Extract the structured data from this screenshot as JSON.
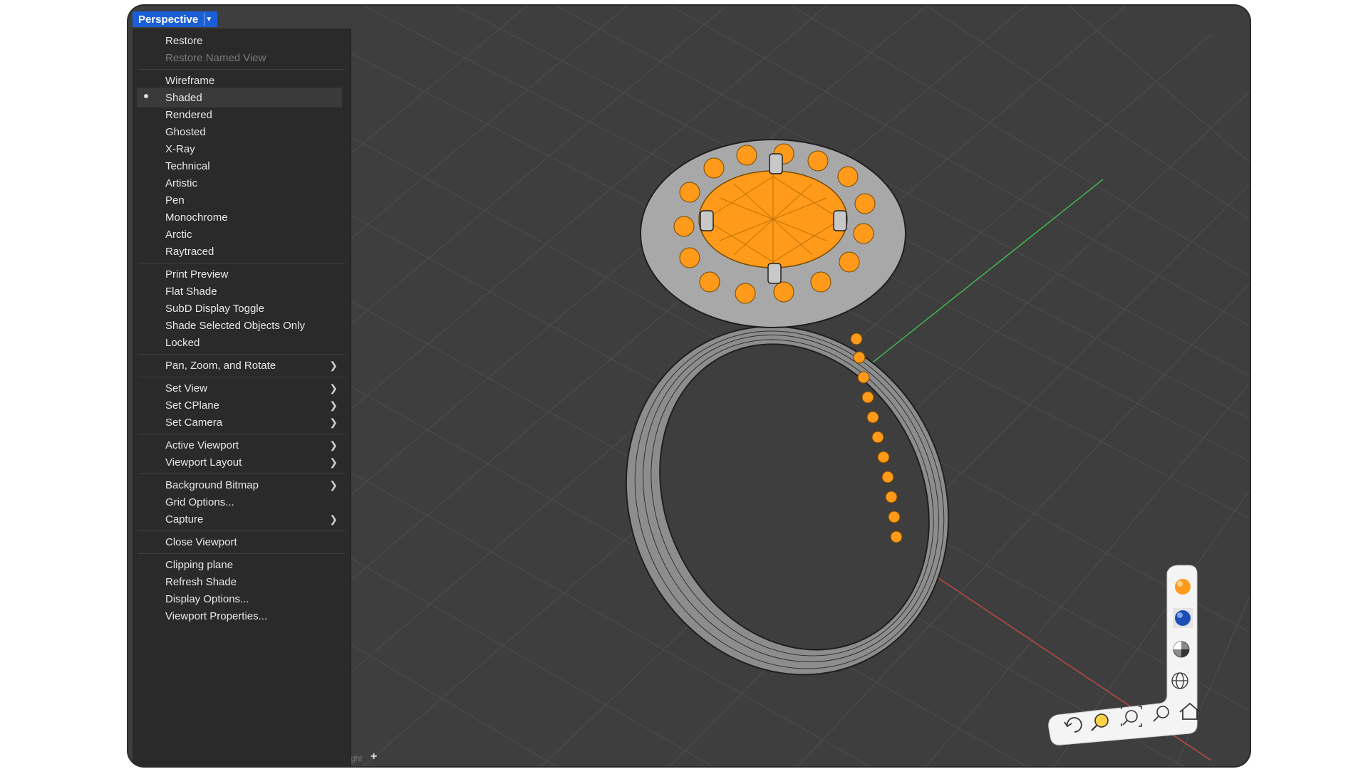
{
  "viewport": {
    "title": "Perspective",
    "dropdown_icon": "chevron-down-icon",
    "bottom_tab_fragment": "ght",
    "add_tab_icon": "plus-icon"
  },
  "menu": {
    "items": [
      {
        "label": "Restore"
      },
      {
        "label": "Restore Named View",
        "disabled": true
      },
      {
        "label": "Wireframe"
      },
      {
        "label": "Shaded",
        "checked": true
      },
      {
        "label": "Rendered"
      },
      {
        "label": "Ghosted"
      },
      {
        "label": "X-Ray"
      },
      {
        "label": "Technical"
      },
      {
        "label": "Artistic"
      },
      {
        "label": "Pen"
      },
      {
        "label": "Monochrome"
      },
      {
        "label": "Arctic"
      },
      {
        "label": "Raytraced"
      },
      {
        "label": "Print Preview"
      },
      {
        "label": "Flat Shade"
      },
      {
        "label": "SubD Display Toggle"
      },
      {
        "label": "Shade Selected Objects Only"
      },
      {
        "label": "Locked"
      },
      {
        "label": "Pan, Zoom, and Rotate",
        "submenu": true
      },
      {
        "label": "Set View",
        "submenu": true
      },
      {
        "label": "Set CPlane",
        "submenu": true
      },
      {
        "label": "Set Camera",
        "submenu": true
      },
      {
        "label": "Active Viewport",
        "submenu": true
      },
      {
        "label": "Viewport Layout",
        "submenu": true
      },
      {
        "label": "Background Bitmap",
        "submenu": true
      },
      {
        "label": "Grid Options..."
      },
      {
        "label": "Capture",
        "submenu": true
      },
      {
        "label": "Close Viewport"
      },
      {
        "label": "Clipping plane"
      },
      {
        "label": "Refresh Shade"
      },
      {
        "label": "Display Options..."
      },
      {
        "label": "Viewport Properties..."
      }
    ],
    "submenu_icon": "chevron-right-icon",
    "check_icon": "bullet-icon"
  },
  "navigation_widget": {
    "vertical": [
      "rendered-sphere-icon",
      "blue-sphere-icon",
      "shaded-sphere-icon",
      "wireframe-sphere-icon"
    ],
    "horizontal": [
      "rotate-icon",
      "zoom-icon",
      "zoom-extents-icon",
      "zoom-1to1-icon",
      "home-icon"
    ]
  },
  "colors": {
    "accent": "#1a5fd6",
    "selection": "#ff9a1a",
    "background": "#3e3e3e",
    "menu_background": "#2a2a2a",
    "x_axis": "#c24a4a",
    "y_axis": "#3fb34a"
  }
}
